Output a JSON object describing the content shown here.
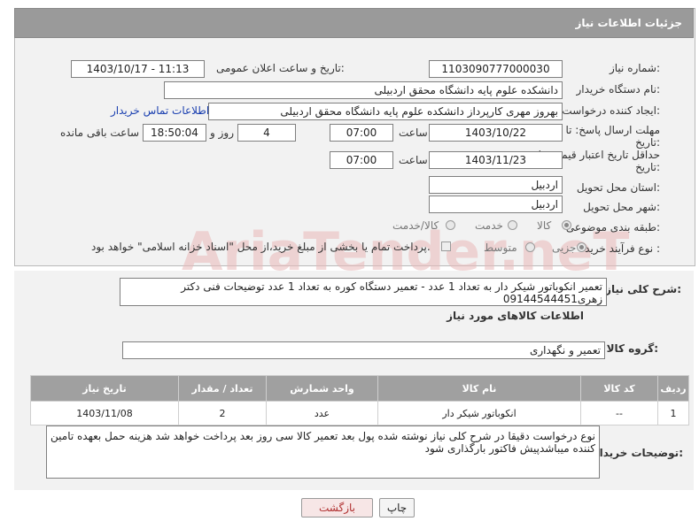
{
  "header": {
    "title": "جزئیات اطلاعات نیاز"
  },
  "fields": {
    "need_number_label": "شماره نیاز:",
    "need_number": "1103090777000030",
    "announce_label": "تاریخ و ساعت اعلان عمومی:",
    "announce_value": "1403/10/17 - 11:13",
    "buyer_org_label": "نام دستگاه خریدار:",
    "buyer_org": "دانشکده علوم پایه دانشگاه محقق اردبیلی",
    "creator_label": "ایجاد کننده درخواست:",
    "creator": "بهروز مهری  کارپرداز  دانشکده علوم پایه دانشگاه محقق اردبیلی",
    "contact_link": "اطلاعات تماس خریدار",
    "deadline_label": "مهلت ارسال پاسخ: تا",
    "deadline_label2": "تاریخ:",
    "deadline_date": "1403/10/22",
    "time_label": "ساعت",
    "deadline_time": "07:00",
    "days_value": "4",
    "days_label": "روز و",
    "remaining_time": "18:50:04",
    "remaining_label": "ساعت باقی مانده",
    "validity_label": "حداقل تاریخ اعتبار قیمت: تا",
    "validity_label2": "تاریخ:",
    "validity_date": "1403/11/23",
    "validity_time": "07:00",
    "province_label": "استان محل تحویل:",
    "province": "اردبیل",
    "city_label": "شهر محل تحویل:",
    "city": "اردبیل",
    "category_label": "طبقه بندی موضوعی:",
    "category_options": [
      "کالا",
      "خدمت",
      "کالا/خدمت"
    ],
    "process_label": "نوع فرآیند خرید :",
    "process_options": [
      "جزیی",
      "متوسط"
    ],
    "payment_note": "پرداخت تمام یا بخشی از مبلغ خرید،از محل \"اسناد خزانه اسلامی\" خواهد بود."
  },
  "summary": {
    "label": "شرح کلی نیاز:",
    "text": "تعمیر انکوباتور شیکر دار  به تعداد 1 عدد - تعمیر دستگاه کوره به تعداد 1 عدد توضیحات فنی دکتر زهری09144544451"
  },
  "goods": {
    "section_title": "اطلاعات کالاهای مورد نیاز",
    "group_label": "گروه کالا:",
    "group_value": "تعمیر و نگهداری",
    "columns": [
      "ردیف",
      "کد کالا",
      "نام کالا",
      "واحد شمارش",
      "تعداد / مقدار",
      "تاریخ نیاز"
    ],
    "rows": [
      {
        "row": "1",
        "code": "--",
        "name": "انکوباتور شیکر دار",
        "unit": "عدد",
        "qty": "2",
        "date": "1403/11/08"
      }
    ]
  },
  "buyer_notes": {
    "label": "توضیحات خریدار:",
    "text": "نوع درخواست دقیقا در شرح کلی نیاز نوشته شده پول بعد تعمیر کالا سی روز بعد پرداخت خواهد شد هزینه حمل بعهده تامین کننده میباشدپیش فاکتور بارگذاری شود"
  },
  "buttons": {
    "print": "چاپ",
    "back": "بازگشت"
  },
  "watermark": "AriaTender.neT"
}
